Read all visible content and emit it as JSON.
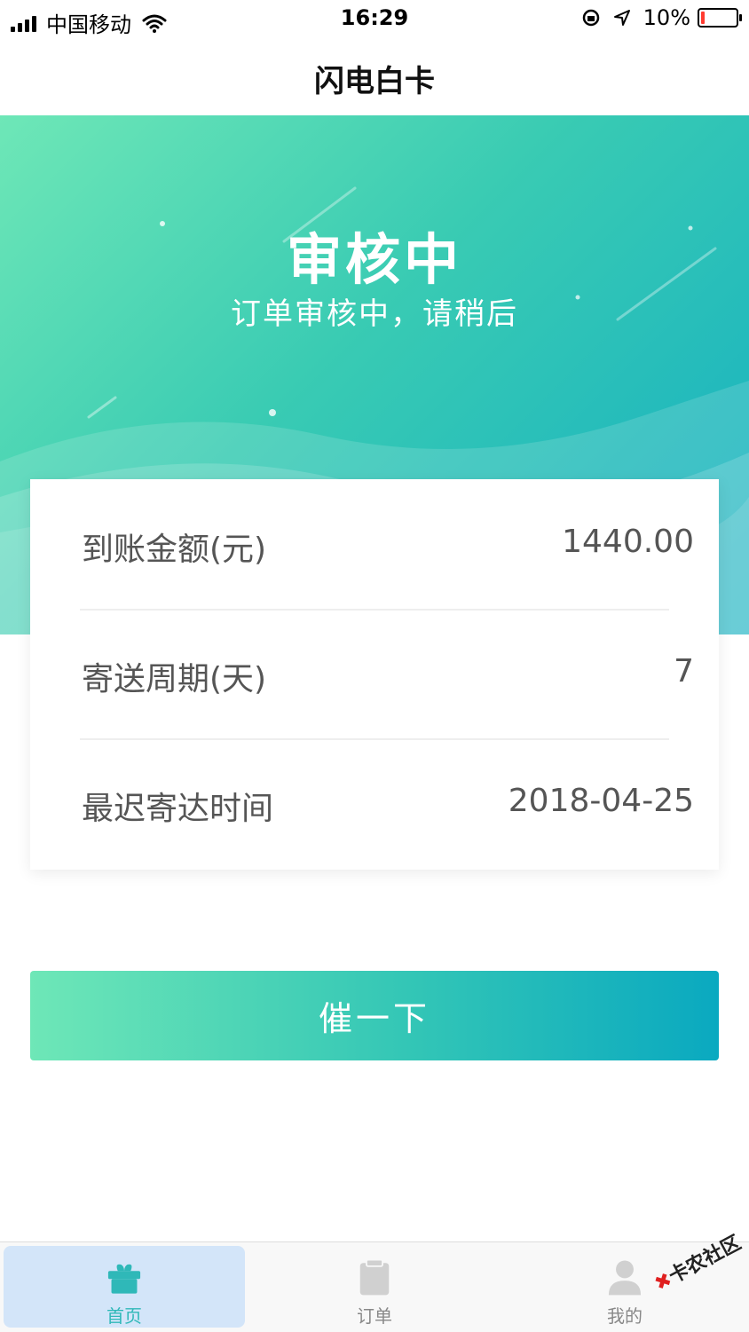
{
  "status_bar": {
    "carrier": "中国移动",
    "time": "16:29",
    "battery_percent": "10%",
    "battery_level": 0.1
  },
  "nav": {
    "title": "闪电白卡"
  },
  "hero": {
    "title": "审核中",
    "subtitle": "订单审核中，请稍后"
  },
  "info": {
    "rows": [
      {
        "label": "到账金额(元)",
        "value": "1440.00"
      },
      {
        "label": "寄送周期(天)",
        "value": "7"
      },
      {
        "label": "最迟寄达时间",
        "value": "2018-04-25"
      }
    ]
  },
  "actions": {
    "urge_label": "催一下"
  },
  "tabs": [
    {
      "label": "首页",
      "icon": "gift-box-icon",
      "active": true
    },
    {
      "label": "订单",
      "icon": "clipboard-icon",
      "active": false
    },
    {
      "label": "我的",
      "icon": "user-icon",
      "active": false
    }
  ],
  "watermark": {
    "text": "卡农社区"
  },
  "colors": {
    "accent_start": "#6ee7b7",
    "accent_end": "#0aa9c0",
    "tab_active_bg": "#d3e5f9",
    "tab_active_text": "#2fb8b8",
    "battery_low": "#ff3b30"
  }
}
